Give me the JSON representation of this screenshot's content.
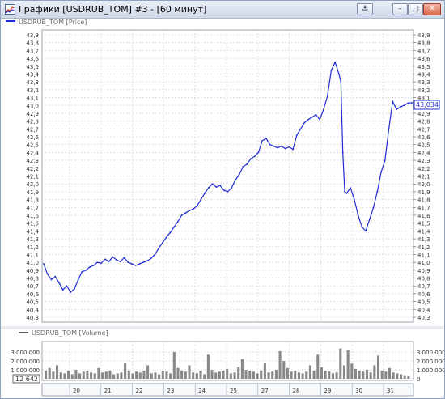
{
  "window": {
    "title": "Графики [USDRUB_TOM] #3 - [60 минут]",
    "buttons": {
      "pin": "⚓",
      "minimize": "–",
      "maximize": "□",
      "close": "✕"
    }
  },
  "price_panel": {
    "legend": "USDRUB_TOM [Price]",
    "last_price_label": "43,034",
    "line_color": "#1f2bd6"
  },
  "volume_panel": {
    "legend": "USDRUB_TOM [Volume]",
    "last_volume_label": "12 642",
    "bar_color": "#888888"
  },
  "chart_data": [
    {
      "type": "line",
      "series": [
        {
          "name": "USDRUB_TOM [Price]"
        }
      ],
      "ylim": [
        40.3,
        43.9
      ],
      "yticks": [
        "43,9",
        "43,8",
        "43,7",
        "43,6",
        "43,5",
        "43,4",
        "43,3",
        "43,2",
        "43,1",
        "43,0",
        "42,9",
        "42,8",
        "42,7",
        "42,6",
        "42,5",
        "42,4",
        "42,3",
        "42,2",
        "42,1",
        "42,0",
        "41,9",
        "41,8",
        "41,7",
        "41,6",
        "41,5",
        "41,4",
        "41,3",
        "41,2",
        "41,1",
        "41,0",
        "40,9",
        "40,8",
        "40,7",
        "40,6",
        "40,5",
        "40,4",
        "40,3"
      ],
      "xticks": [
        "20",
        "21",
        "22",
        "23",
        "24",
        "25",
        "27",
        "28",
        "29",
        "30",
        "31"
      ],
      "points": [
        [
          0,
          40.98
        ],
        [
          2,
          40.85
        ],
        [
          4,
          40.78
        ],
        [
          6,
          40.82
        ],
        [
          8,
          40.74
        ],
        [
          10,
          40.65
        ],
        [
          12,
          40.7
        ],
        [
          14,
          40.62
        ],
        [
          16,
          40.66
        ],
        [
          18,
          40.78
        ],
        [
          20,
          40.88
        ],
        [
          22,
          40.9
        ],
        [
          24,
          40.94
        ],
        [
          26,
          40.96
        ],
        [
          28,
          41.0
        ],
        [
          30,
          40.99
        ],
        [
          32,
          41.04
        ],
        [
          34,
          41.01
        ],
        [
          36,
          41.07
        ],
        [
          38,
          41.03
        ],
        [
          40,
          41.01
        ],
        [
          42,
          41.06
        ],
        [
          44,
          41.0
        ],
        [
          46,
          40.98
        ],
        [
          48,
          40.96
        ],
        [
          50,
          40.98
        ],
        [
          52,
          41.0
        ],
        [
          54,
          41.02
        ],
        [
          56,
          41.05
        ],
        [
          58,
          41.1
        ],
        [
          60,
          41.18
        ],
        [
          62,
          41.25
        ],
        [
          64,
          41.32
        ],
        [
          66,
          41.38
        ],
        [
          68,
          41.45
        ],
        [
          70,
          41.52
        ],
        [
          72,
          41.6
        ],
        [
          74,
          41.63
        ],
        [
          76,
          41.66
        ],
        [
          78,
          41.68
        ],
        [
          80,
          41.72
        ],
        [
          82,
          41.8
        ],
        [
          84,
          41.88
        ],
        [
          86,
          41.95
        ],
        [
          88,
          42.0
        ],
        [
          90,
          41.96
        ],
        [
          92,
          41.98
        ],
        [
          94,
          41.92
        ],
        [
          96,
          41.9
        ],
        [
          98,
          41.95
        ],
        [
          100,
          42.05
        ],
        [
          102,
          42.12
        ],
        [
          104,
          42.22
        ],
        [
          106,
          42.25
        ],
        [
          108,
          42.32
        ],
        [
          110,
          42.35
        ],
        [
          112,
          42.4
        ],
        [
          114,
          42.55
        ],
        [
          116,
          42.58
        ],
        [
          118,
          42.5
        ],
        [
          120,
          42.48
        ],
        [
          122,
          42.46
        ],
        [
          124,
          42.48
        ],
        [
          126,
          42.45
        ],
        [
          128,
          42.47
        ],
        [
          130,
          42.44
        ],
        [
          132,
          42.62
        ],
        [
          134,
          42.7
        ],
        [
          136,
          42.78
        ],
        [
          138,
          42.82
        ],
        [
          140,
          42.85
        ],
        [
          142,
          42.88
        ],
        [
          144,
          42.82
        ],
        [
          146,
          42.95
        ],
        [
          148,
          43.12
        ],
        [
          150,
          43.45
        ],
        [
          152,
          43.55
        ],
        [
          154,
          43.4
        ],
        [
          155,
          43.3
        ],
        [
          156,
          42.4
        ],
        [
          157,
          41.9
        ],
        [
          158,
          41.88
        ],
        [
          160,
          41.95
        ],
        [
          162,
          41.8
        ],
        [
          164,
          41.6
        ],
        [
          166,
          41.45
        ],
        [
          168,
          41.4
        ],
        [
          170,
          41.55
        ],
        [
          172,
          41.7
        ],
        [
          174,
          41.9
        ],
        [
          176,
          42.15
        ],
        [
          178,
          42.3
        ],
        [
          180,
          42.7
        ],
        [
          182,
          43.05
        ],
        [
          184,
          42.95
        ],
        [
          186,
          42.98
        ],
        [
          188,
          43.0
        ],
        [
          190,
          43.03
        ],
        [
          192,
          43.034
        ]
      ],
      "point_x_range": [
        0,
        192
      ]
    },
    {
      "type": "bar",
      "series": [
        {
          "name": "USDRUB_TOM [Volume]"
        }
      ],
      "ylim": [
        0,
        4000000
      ],
      "yticks": [
        "3 000 000",
        "2 000 000",
        "1 000 000",
        "0"
      ],
      "values": [
        900000,
        1200000,
        800000,
        1500000,
        700000,
        600000,
        900000,
        500000,
        1000000,
        600000,
        800000,
        900000,
        700000,
        600000,
        1200000,
        700000,
        800000,
        900000,
        500000,
        600000,
        700000,
        1800000,
        900000,
        600000,
        800000,
        700000,
        900000,
        1500000,
        600000,
        700000,
        500000,
        900000,
        800000,
        600000,
        3000000,
        1200000,
        900000,
        800000,
        1500000,
        700000,
        600000,
        900000,
        500000,
        2700000,
        1000000,
        700000,
        800000,
        900000,
        1100000,
        600000,
        700000,
        1300000,
        2200000,
        1000000,
        900000,
        800000,
        600000,
        900000,
        1800000,
        700000,
        800000,
        1000000,
        3100000,
        2000000,
        1200000,
        800000,
        900000,
        700000,
        600000,
        800000,
        1500000,
        900000,
        2700000,
        1300000,
        900000,
        800000,
        600000,
        700000,
        3400000,
        1500000,
        3200000,
        1700000,
        1100000,
        900000,
        800000,
        1000000,
        700000,
        1500000,
        2600000,
        900000,
        800000,
        1200000,
        700000,
        600000,
        500000,
        400000,
        300000
      ]
    }
  ]
}
